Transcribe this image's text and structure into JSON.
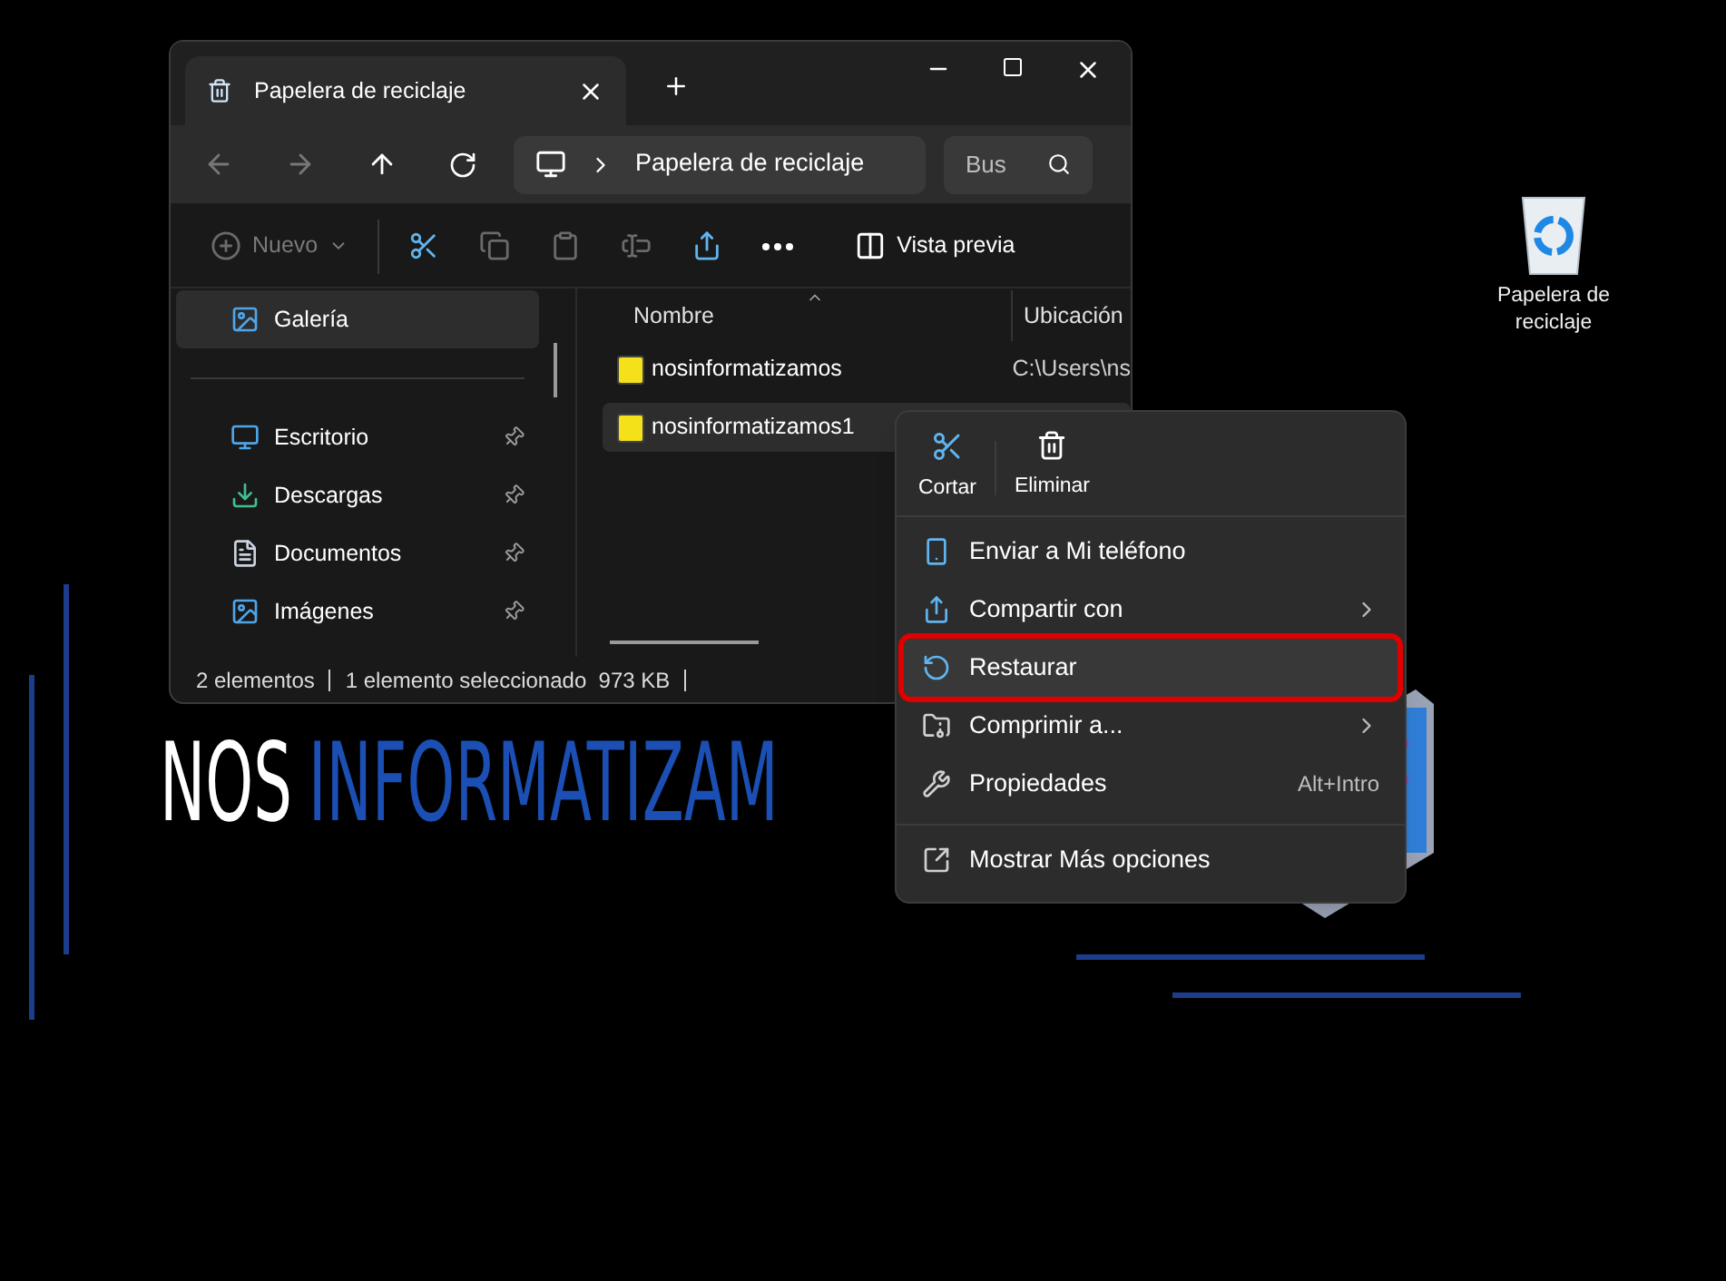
{
  "desktop_icon": {
    "label": "Papelera de reciclaje"
  },
  "logo": {
    "first": "NOS",
    "second": "INFORMATIZAM"
  },
  "window": {
    "tabs": [
      {
        "title": "Papelera de reciclaje",
        "selected": true
      }
    ],
    "address": {
      "location": "Papelera de reciclaje"
    },
    "search": {
      "placeholder": "Bus"
    },
    "toolbar": [
      {
        "kind": "new",
        "label": "Nuevo",
        "disabled": true
      },
      {
        "kind": "cut",
        "disabled": false
      },
      {
        "kind": "copy",
        "disabled": true
      },
      {
        "kind": "paste",
        "disabled": true
      },
      {
        "kind": "rename",
        "disabled": true
      },
      {
        "kind": "share",
        "disabled": false
      },
      {
        "kind": "more",
        "disabled": false
      },
      {
        "kind": "preview",
        "label": "Vista previa",
        "disabled": false
      }
    ],
    "sidebar": {
      "sections": [
        [
          {
            "label": "Galería",
            "pinned": false,
            "selected": true
          }
        ],
        [
          {
            "label": "Escritorio",
            "pinned": true,
            "selected": false
          },
          {
            "label": "Descargas",
            "pinned": true,
            "selected": false
          },
          {
            "label": "Documentos",
            "pinned": true,
            "selected": false
          },
          {
            "label": "Imágenes",
            "pinned": true,
            "selected": false
          }
        ]
      ]
    },
    "table": {
      "columns": [
        "Nombre",
        "Ubicación"
      ],
      "rows": [
        {
          "name": "nosinformatizamos",
          "location": "C:\\Users\\ns",
          "selected": false
        },
        {
          "name": "nosinformatizamos1",
          "selected": true
        }
      ]
    },
    "status_bar": [
      "2 elementos",
      "1 elemento seleccionado  973 KB"
    ]
  },
  "context_menu": {
    "actions": [
      {
        "label": "Cortar"
      },
      {
        "label": "Eliminar"
      }
    ],
    "groups": [
      [
        {
          "label": "Enviar a Mi teléfono",
          "submenu": false,
          "highlighted": false
        },
        {
          "label": "Compartir con",
          "submenu": true,
          "highlighted": false
        },
        {
          "label": "Restaurar",
          "submenu": false,
          "highlighted": true
        },
        {
          "label": "Comprimir a...",
          "submenu": true,
          "highlighted": false
        },
        {
          "label": "Propiedades",
          "submenu": false,
          "highlighted": false,
          "shortcut": "Alt+Intro"
        }
      ],
      [
        {
          "label": "Mostrar Más opciones",
          "submenu": false,
          "highlighted": false
        }
      ]
    ]
  }
}
